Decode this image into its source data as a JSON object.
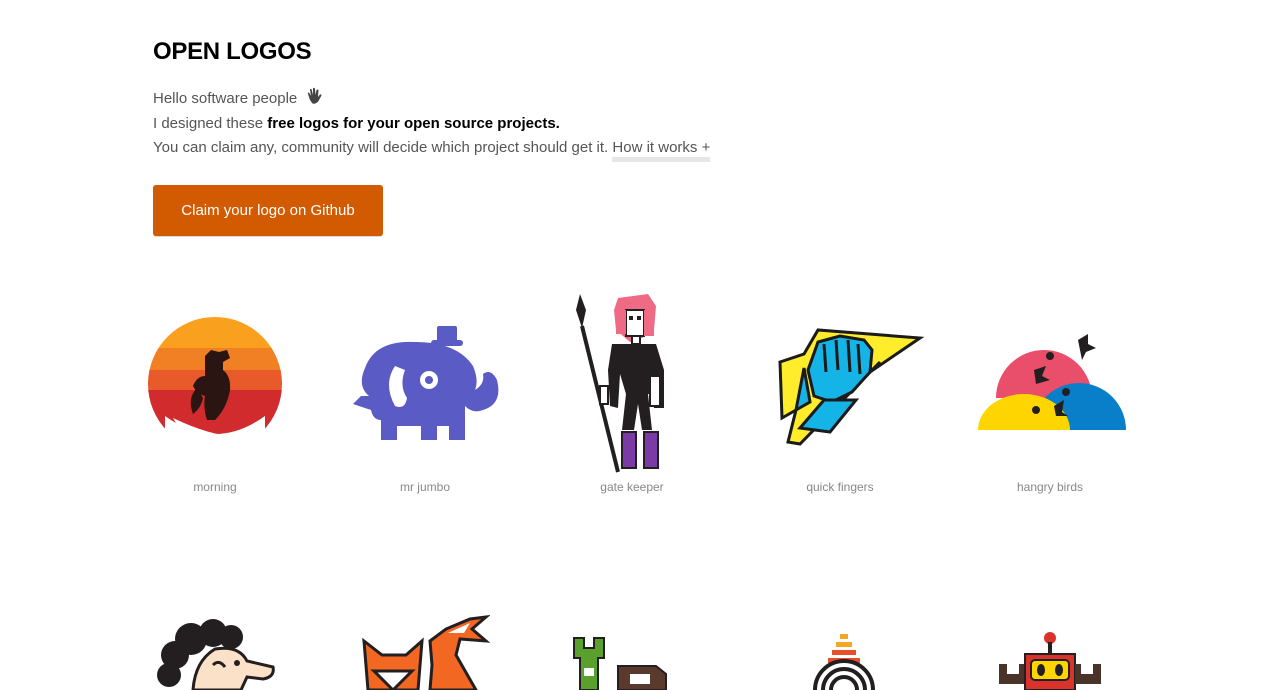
{
  "page": {
    "title": "OPEN LOGOS",
    "intro": {
      "line1": "Hello software people",
      "line2_prefix": "I designed these ",
      "line2_bold": "free logos for your open source projects.",
      "line3": "You can claim any, community will decide which project should get it. ",
      "how_link": "How it works +"
    },
    "cta_label": "Claim your logo on Github"
  },
  "logos_row1": [
    {
      "name": "morning",
      "icon": "rooster-sunrise-icon"
    },
    {
      "name": "mr jumbo",
      "icon": "elephant-icon"
    },
    {
      "name": "gate keeper",
      "icon": "spear-warrior-icon"
    },
    {
      "name": "quick fingers",
      "icon": "fist-lightning-icon"
    },
    {
      "name": "hangry birds",
      "icon": "birds-icon"
    }
  ],
  "logos_row2": [
    {
      "icon": "curly-hair-man-icon"
    },
    {
      "icon": "fox-icon"
    },
    {
      "icon": "pixel-creature-icon"
    },
    {
      "icon": "tower-rings-icon"
    },
    {
      "icon": "robot-icon"
    }
  ],
  "colors": {
    "accent": "#d25a00",
    "elephant": "#5a5bc4",
    "hangry_pink": "#e94e6b",
    "hangry_blue": "#0a7fc9",
    "hangry_yellow": "#ffd500"
  }
}
